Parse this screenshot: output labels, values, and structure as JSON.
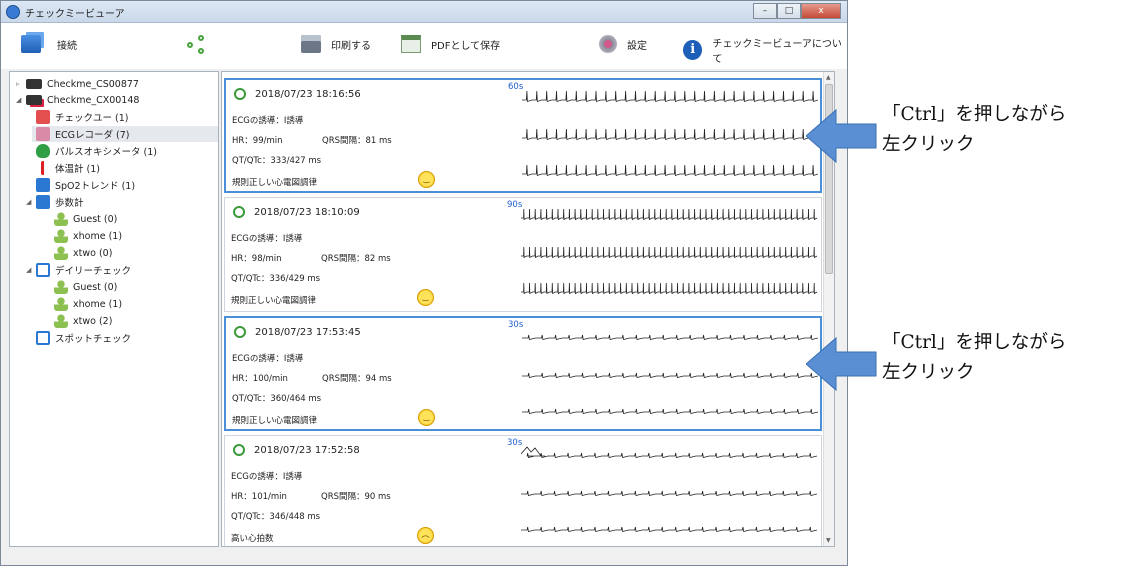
{
  "window": {
    "title": "チェックミービューア",
    "buttons": [
      "–",
      "□",
      "x"
    ]
  },
  "toolbar": {
    "connect": "接続",
    "print": "印刷する",
    "pdf": "PDFとして保存",
    "settings": "設定",
    "about": "チェックミービューアについて"
  },
  "tree": [
    {
      "label": "Checkme_CS00877",
      "icon": "device-icon",
      "arrow": "▹"
    },
    {
      "label": "Checkme_CX00148",
      "icon": "device-icon",
      "arrow": "◢"
    },
    {
      "label": "チェックユー (1)",
      "icon": "heart-icon"
    },
    {
      "label": "ECGレコーダ (7)",
      "icon": "ecg-icon",
      "selected": true
    },
    {
      "label": "パルスオキシメータ (1)",
      "icon": "drop-icon"
    },
    {
      "label": "体温計 (1)",
      "icon": "thermometer-icon"
    },
    {
      "label": "SpO2トレンド (1)",
      "icon": "trend-icon"
    },
    {
      "label": "歩数計",
      "icon": "pedometer-icon",
      "arrow": "◢"
    },
    {
      "label": "Guest (0)",
      "icon": "user-icon"
    },
    {
      "label": "xhome (1)",
      "icon": "user-icon"
    },
    {
      "label": "xtwo (0)",
      "icon": "user-icon"
    },
    {
      "label": "デイリーチェック",
      "icon": "stethoscope-icon",
      "arrow": "◢"
    },
    {
      "label": "Guest (0)",
      "icon": "user-icon"
    },
    {
      "label": "xhome (1)",
      "icon": "user-icon"
    },
    {
      "label": "xtwo (2)",
      "icon": "user-icon"
    },
    {
      "label": "スポットチェック",
      "icon": "stethoscope-icon"
    }
  ],
  "records": [
    {
      "datetime": "2018/07/23 18:16:56",
      "lead": "ECGの誘導：I誘導",
      "hr": "HR：99/min",
      "qrs": "QRS間隔：81 ms",
      "qtc": "QT/QTc：333/427 ms",
      "result": "規則正しい心電図調律",
      "duration": "60s",
      "mood": "smile",
      "selected": true
    },
    {
      "datetime": "2018/07/23 18:10:09",
      "lead": "ECGの誘導：I誘導",
      "hr": "HR：98/min",
      "qrs": "QRS間隔：82 ms",
      "qtc": "QT/QTc：336/429 ms",
      "result": "規則正しい心電図調律",
      "duration": "90s",
      "mood": "smile",
      "selected": false
    },
    {
      "datetime": "2018/07/23 17:53:45",
      "lead": "ECGの誘導：I誘導",
      "hr": "HR：100/min",
      "qrs": "QRS間隔：94 ms",
      "qtc": "QT/QTc：360/464 ms",
      "result": "規則正しい心電図調律",
      "duration": "30s",
      "mood": "smile",
      "selected": true
    },
    {
      "datetime": "2018/07/23 17:52:58",
      "lead": "ECGの誘導：I誘導",
      "hr": "HR：101/min",
      "qrs": "QRS間隔：90 ms",
      "qtc": "QT/QTc：346/448 ms",
      "result": "高い心拍数",
      "duration": "30s",
      "mood": "sad",
      "selected": false
    }
  ],
  "annotations": [
    {
      "line1": "「Ctrl」を押しながら",
      "line2": "左クリック"
    },
    {
      "line1": "「Ctrl」を押しながら",
      "line2": "左クリック"
    }
  ],
  "colors": {
    "selection_border": "#4a8fd8",
    "duration_text": "#1f5fd0",
    "annotation_arrow": "#5b8fd4"
  }
}
